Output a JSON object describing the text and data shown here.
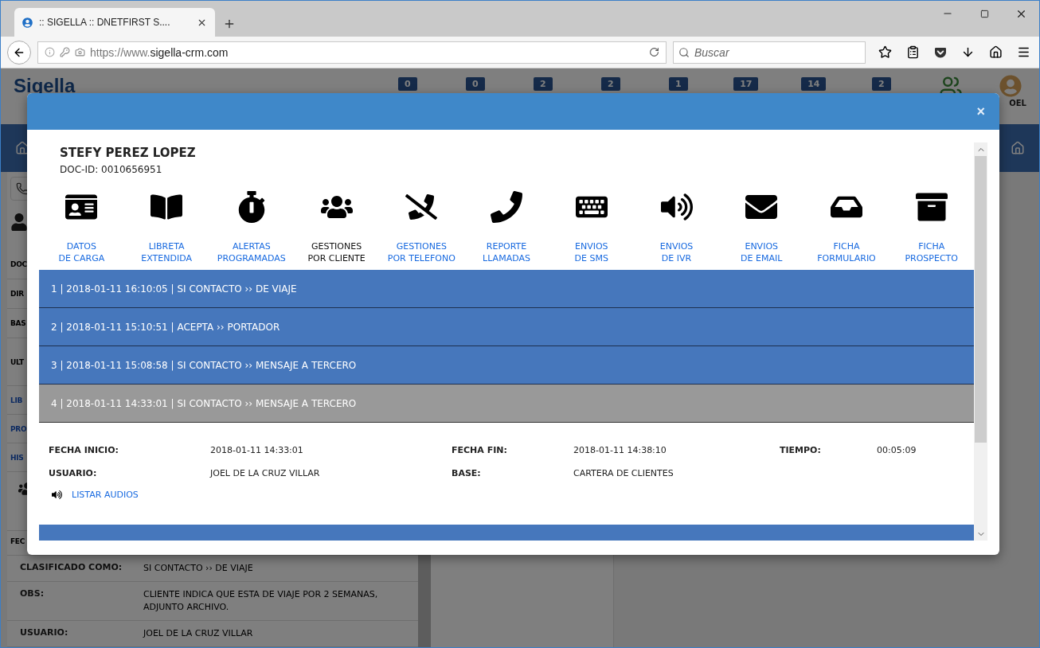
{
  "browser": {
    "tab_title": ":: SIGELLA :: DNETFIRST S....",
    "url_prefix": "https://www.",
    "url_domain": "sigella-crm.com",
    "search_placeholder": "Buscar"
  },
  "app": {
    "logo": "Sigella",
    "badges": [
      "0",
      "0",
      "2",
      "2",
      "1",
      "17",
      "14",
      "2"
    ],
    "user": "OEL",
    "sidebar_rows": [
      {
        "label": "DOC",
        "kind": "field"
      },
      {
        "label": "DIR",
        "kind": "field"
      },
      {
        "label": "BAS",
        "kind": "field"
      },
      {
        "label": "ULT",
        "kind": "tall"
      },
      {
        "label": "LIB",
        "kind": "link"
      },
      {
        "label": "PRO",
        "kind": "link"
      },
      {
        "label": "HIS",
        "kind": "link"
      }
    ],
    "detail_rows": [
      {
        "label": "FEC"
      },
      {
        "label": "CLASIFICADO COMO:",
        "value": "SI CONTACTO ›› DE VIAJE"
      },
      {
        "label": "OBS:",
        "value": "CLIENTE INDICA QUE ESTA DE VIAJE POR 2 SEMANAS, ADJUNTO ARCHIVO."
      },
      {
        "label": "USUARIO:",
        "value": "JOEL DE LA CRUZ VILLAR"
      }
    ]
  },
  "modal": {
    "close": "×",
    "name": "STEFY PEREZ LOPEZ",
    "doc_id": "DOC-ID: 0010656951",
    "actions": [
      {
        "label": "DATOS\nDE CARGA",
        "selected": false
      },
      {
        "label": "LIBRETA\nEXTENDIDA",
        "selected": false
      },
      {
        "label": "ALERTAS\nPROGRAMADAS",
        "selected": false
      },
      {
        "label": "GESTIONES\nPOR CLIENTE",
        "selected": true
      },
      {
        "label": "GESTIONES\nPOR TELEFONO",
        "selected": false
      },
      {
        "label": "REPORTE\nLLAMADAS",
        "selected": false
      },
      {
        "label": "ENVIOS\nDE SMS",
        "selected": false
      },
      {
        "label": "ENVIOS\nDE IVR",
        "selected": false
      },
      {
        "label": "ENVIOS\nDE EMAIL",
        "selected": false
      },
      {
        "label": "FICHA\nFORMULARIO",
        "selected": false
      },
      {
        "label": "FICHA\nPROSPECTO",
        "selected": false
      }
    ],
    "history": [
      {
        "text": "1 | 2018-01-11 16:10:05 | SI CONTACTO ›› DE VIAJE",
        "expanded": false
      },
      {
        "text": "2 | 2018-01-11 15:10:51 | ACEPTA ›› PORTADOR",
        "expanded": false
      },
      {
        "text": "3 | 2018-01-11 15:08:58 | SI CONTACTO ›› MENSAJE A TERCERO",
        "expanded": false
      },
      {
        "text": "4 | 2018-01-11 14:33:01 | SI CONTACTO ›› MENSAJE A TERCERO",
        "expanded": true
      }
    ],
    "detail": {
      "fields": [
        {
          "label": "FECHA INICIO:",
          "value": "2018-01-11 14:33:01"
        },
        {
          "label": "FECHA FIN:",
          "value": "2018-01-11 14:38:10"
        },
        {
          "label": "TIEMPO:",
          "value": "00:05:09"
        },
        {
          "label": "USUARIO:",
          "value": "JOEL DE LA CRUZ VILLAR"
        },
        {
          "label": "BASE:",
          "value": "CARTERA DE CLIENTES"
        }
      ],
      "audio_link": "LISTAR AUDIOS"
    }
  }
}
